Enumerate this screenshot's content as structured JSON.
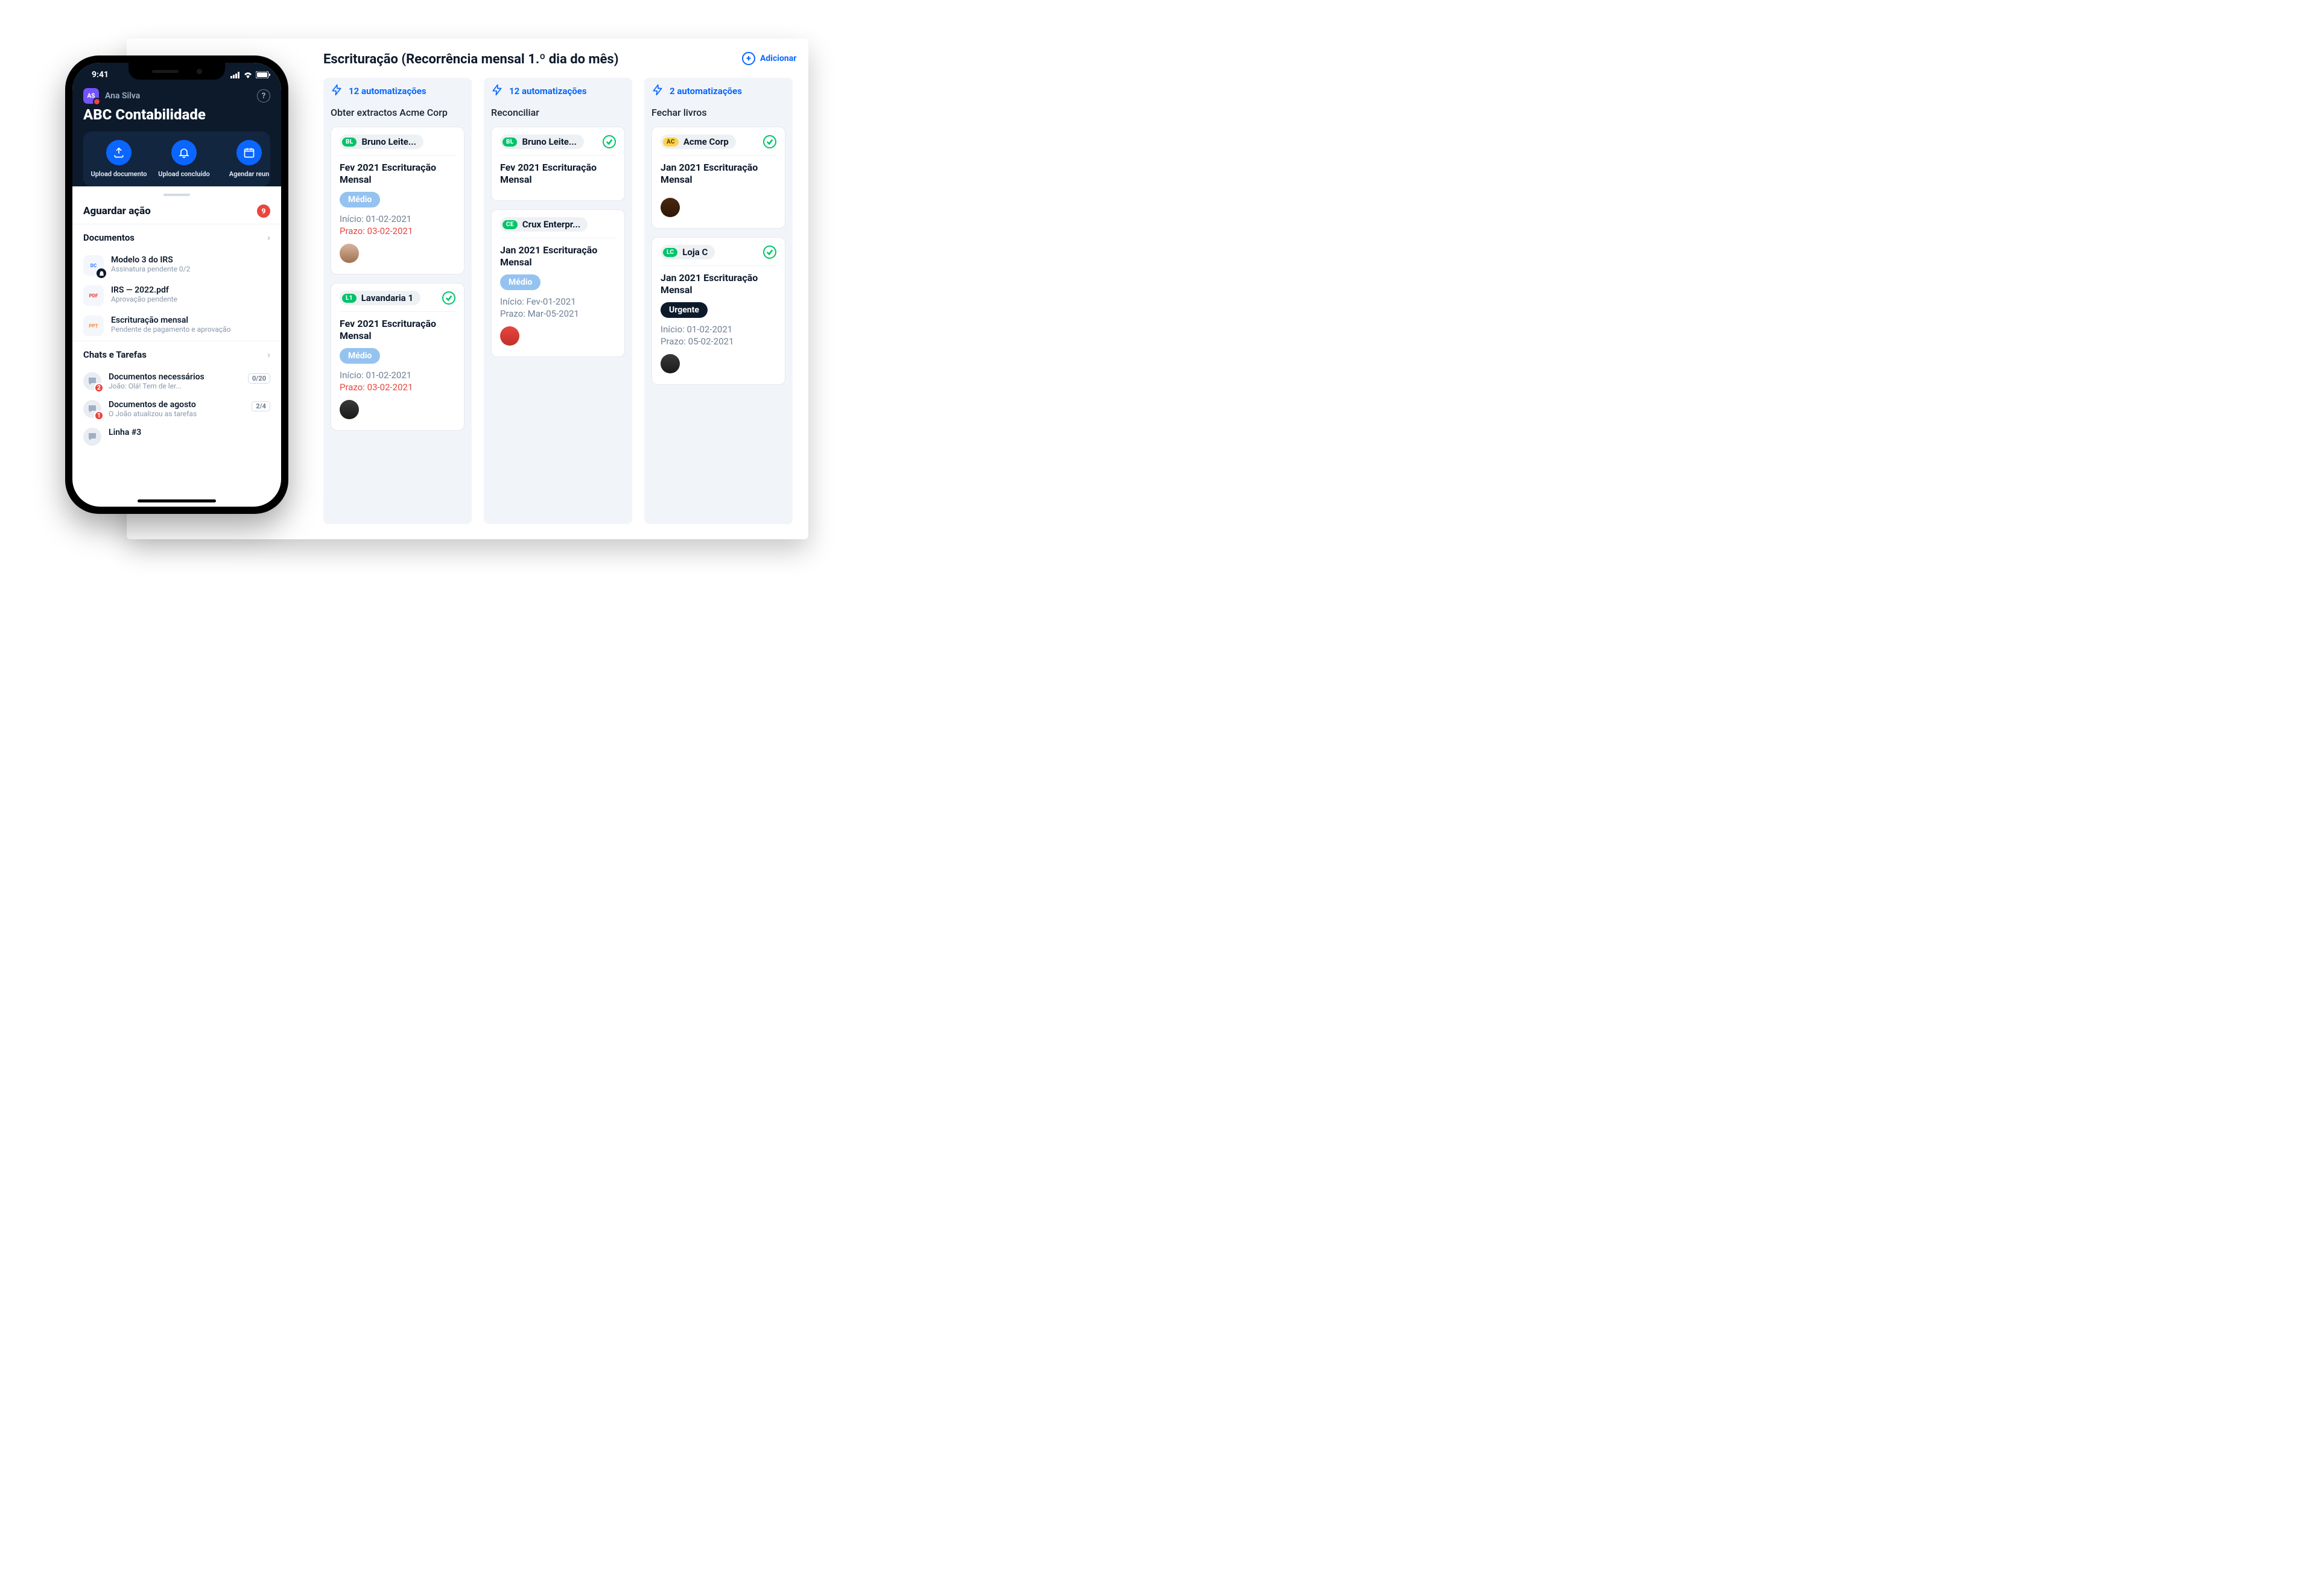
{
  "desktop": {
    "title": "Escrituração (Recorrência mensal 1.º dia do mês)",
    "add_label": "Adicionar",
    "columns": [
      {
        "automations": "12 automatizações",
        "title": "Obter extractos Acme Corp",
        "cards": [
          {
            "badge_initials": "BL",
            "badge_color": "green",
            "person": "Bruno Leite...",
            "checked": false,
            "title": "Fev 2021 Escrituração Mensal",
            "priority": "Médio",
            "priority_class": "prio-medio",
            "start": "Início: 01-02-2021",
            "due": "Prazo: 03-02-2021",
            "due_over": true,
            "avatar_class": "av1"
          },
          {
            "badge_initials": "L1",
            "badge_color": "green",
            "person": "Lavandaria 1",
            "checked": true,
            "title": "Fev 2021 Escrituração Mensal",
            "priority": "Médio",
            "priority_class": "prio-medio",
            "start": "Início: 01-02-2021",
            "due": "Prazo: 03-02-2021",
            "due_over": true,
            "avatar_class": "av2"
          }
        ]
      },
      {
        "automations": "12 automatizações",
        "title": "Reconciliar",
        "cards": [
          {
            "badge_initials": "BL",
            "badge_color": "green",
            "person": "Bruno Leite...",
            "checked": true,
            "title": "Fev 2021 Escrituração Mensal",
            "priority": null,
            "start": null,
            "due": null,
            "avatar_class": null
          },
          {
            "badge_initials": "CE",
            "badge_color": "green",
            "person": "Crux Enterpr...",
            "checked": false,
            "title": "Jan 2021 Escrituração Mensal",
            "priority": "Médio",
            "priority_class": "prio-medio",
            "start": "Início: Fev-01-2021",
            "due": "Prazo: Mar-05-2021",
            "due_over": false,
            "avatar_class": "av3"
          }
        ]
      },
      {
        "automations": "2 automatizações",
        "title": "Fechar livros",
        "cards": [
          {
            "badge_initials": "AC",
            "badge_color": "yellow",
            "person": "Acme Corp",
            "checked": true,
            "title": "Jan 2021 Escrituração Mensal",
            "priority": null,
            "start": null,
            "due": null,
            "avatar_class": "av4"
          },
          {
            "badge_initials": "LC",
            "badge_color": "green",
            "person": "Loja C",
            "checked": true,
            "title": "Jan 2021 Escrituração Mensal",
            "priority": "Urgente",
            "priority_class": "prio-urgente",
            "start": "Início: 01-02-2021",
            "due": "Prazo: 05-02-2021",
            "due_over": false,
            "avatar_class": "av2"
          }
        ]
      }
    ]
  },
  "phone": {
    "time": "9:41",
    "user_initials": "AS",
    "user_name": "Ana Silva",
    "company": "ABC Contabilidade",
    "actions": [
      {
        "label": "Upload documento",
        "icon": "upload"
      },
      {
        "label": "Upload concluído",
        "icon": "bell"
      },
      {
        "label": "Agendar reun",
        "icon": "calendar"
      }
    ],
    "awaiting_title": "Aguardar ação",
    "awaiting_badge": "9",
    "docs_title": "Documentos",
    "docs": [
      {
        "icon": "dc",
        "title": "Modelo 3 do IRS",
        "sub": "Assinatura pendente 0/2",
        "locked": true
      },
      {
        "icon": "pdf",
        "title": "IRS — 2022.pdf",
        "sub": "Aprovação pendente",
        "locked": false
      },
      {
        "icon": "ppt",
        "title": "Escrituração mensal",
        "sub": "Pendente de pagamento e aprovação",
        "locked": false
      }
    ],
    "chats_title": "Chats e Tarefas",
    "chats": [
      {
        "title": "Documentos necessários",
        "sub": "João: Olá! Tem de ler...",
        "badge": "2",
        "count": "0/20"
      },
      {
        "title": "Documentos de agosto",
        "sub": "O João atualizou as tarefas",
        "badge": "1",
        "count": "2/4"
      },
      {
        "title": "Linha #3",
        "sub": "",
        "badge": null,
        "count": null
      }
    ]
  }
}
